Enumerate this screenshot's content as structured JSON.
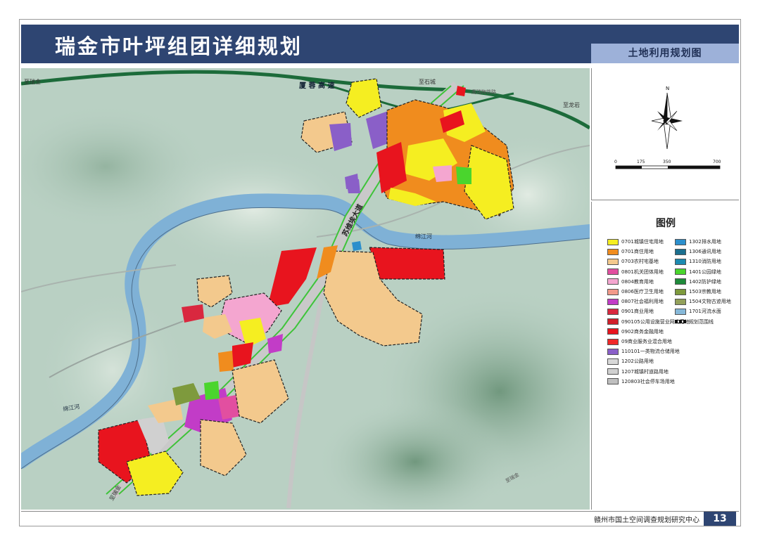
{
  "header": {
    "title": "瑞金市叶坪组团详细规划",
    "subtitle": "土地利用规划图"
  },
  "compass": {
    "north_label": "N"
  },
  "scale_bar": {
    "ticks": [
      "0",
      "175",
      "350",
      "700"
    ]
  },
  "map_labels": {
    "road_zhiruijin": "至瑞金",
    "expressway": "厦 蓉 高 速",
    "road_zhishicheng": "至石城",
    "road_zhilongyan": "至龙岩",
    "road_railway": "鹰瑞梅铁路",
    "avenue": "苏维埃大道",
    "river_mianjiang_right": "绵江河",
    "river_mianjiang_left": "绵江河",
    "road_ruijin_bottom": "至瑞金",
    "road_right_bottom": "至瑞金"
  },
  "legend": {
    "title": "图例",
    "colors": {
      "urban_residential": "#f5ee21",
      "commercial_residential": "#f08c1e",
      "rural_residential": "#f3c98d",
      "government": "#e24fa0",
      "education": "#f4a6d0",
      "medical": "#f29a8a",
      "social_welfare": "#c23cc7",
      "commercial": "#d9283f",
      "public_facility": "#d11f2b",
      "business_finance": "#e8141e",
      "mixed_commercial": "#f02828",
      "logistics": "#8a5fc8",
      "highway": "#d8d8d8",
      "urban_road": "#d0d0d0",
      "parking": "#bfbfbf",
      "drainage": "#2c8fcc",
      "telecom": "#1b6f8e",
      "fire": "#1d8ab0",
      "park": "#4ad52d",
      "protection": "#1f8a3a",
      "religious": "#7e9a3d",
      "heritage": "#93a05a",
      "water": "#86b8d8"
    },
    "left_items": [
      "0701城镇住宅用地",
      "0701商住用地",
      "0703农村宅基地",
      "0801机关团体用地",
      "0804教育用地",
      "0806医疗卫生用地",
      "0807社会福利用地",
      "0901商业用地",
      "090105公用设施营业网点用地",
      "0902商务金融用地",
      "09商业服务业混合用地",
      "110101一类物流仓储用地",
      "1202公路用地",
      "1207城镇村道路用地",
      "120803社会停车场用地"
    ],
    "right_items": [
      "1302排水用地",
      "1306通讯用地",
      "1310消防用地",
      "1401公园绿地",
      "1402防护绿地",
      "1503宗教用地",
      "1504文物古迹用地",
      "1701河流水面",
      "规划范围线"
    ]
  },
  "footer": {
    "organization": "赣州市国土空间调查规划研究中心",
    "page_number": "13"
  }
}
